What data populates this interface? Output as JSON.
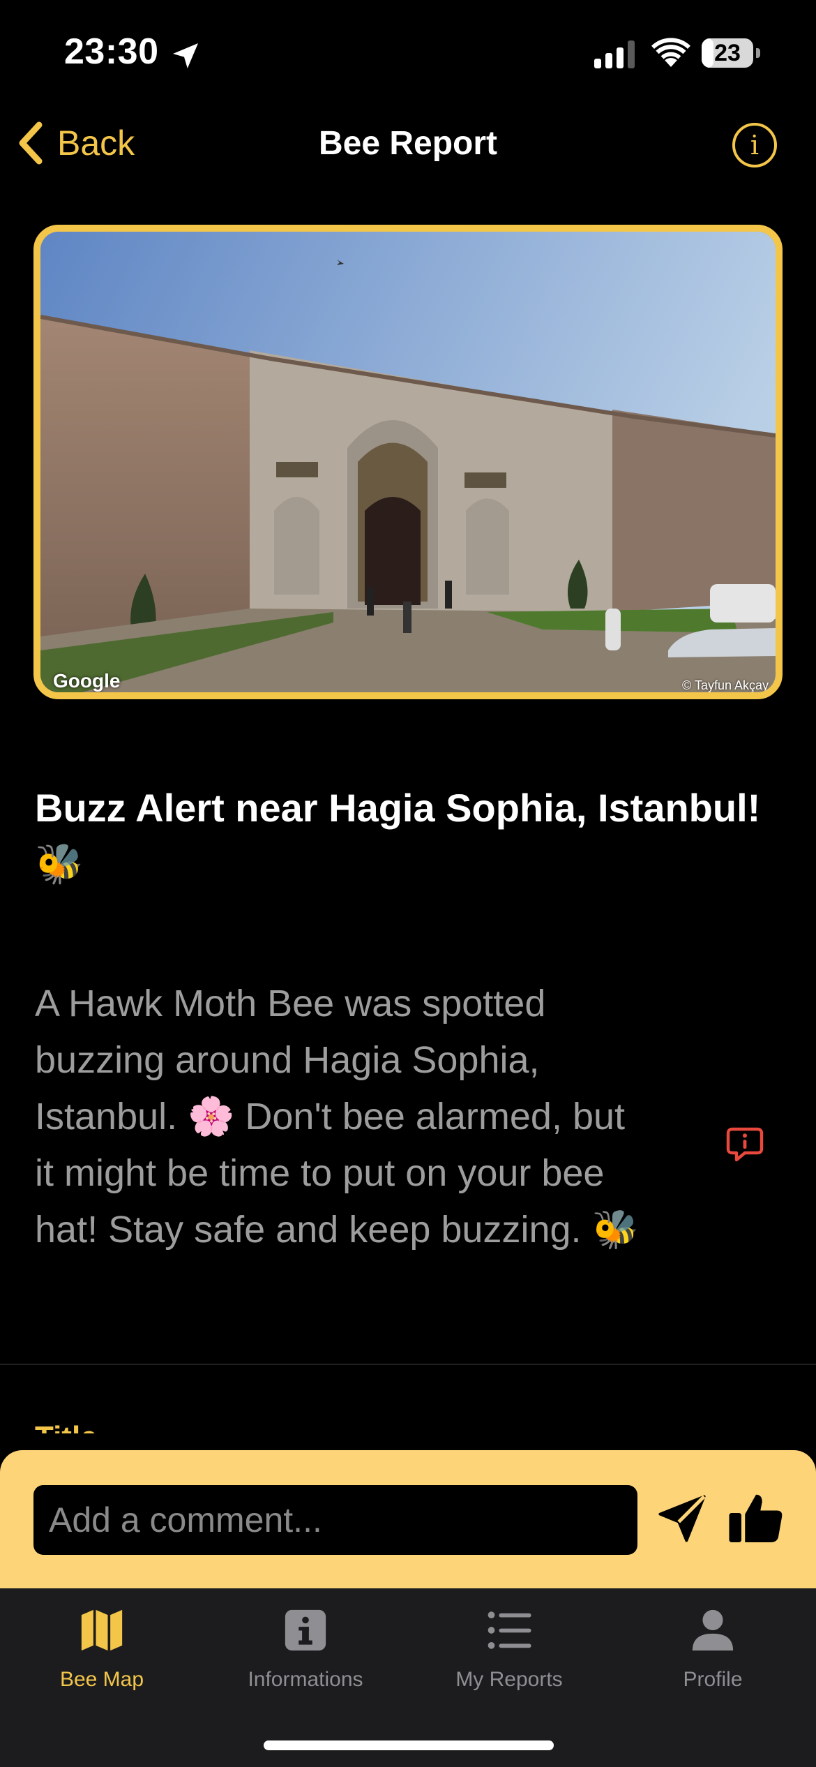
{
  "status": {
    "time": "23:30",
    "battery": "23",
    "battery_level": 0.23,
    "icons": [
      "location-arrow-icon",
      "cellular-signal-icon",
      "wifi-icon",
      "battery-icon"
    ]
  },
  "nav": {
    "back_label": "Back",
    "title": "Bee Report",
    "info_glyph": "i"
  },
  "photo": {
    "watermark": "Google",
    "credit": "© Tayfun Akçay"
  },
  "report": {
    "title": "Buzz Alert near Hagia Sophia, Istanbul! 🐝",
    "body": "A Hawk Moth Bee was spotted buzzing around Hagia Sophia, Istanbul. 🌸 Don't bee alarmed, but it might be time to put on your bee hat! Stay safe and keep buzzing. 🐝",
    "next_field_label": "Title"
  },
  "comment": {
    "placeholder": "Add a comment..."
  },
  "tabs": [
    {
      "label": "Bee Map",
      "icon": "map-icon",
      "active": true
    },
    {
      "label": "Informations",
      "icon": "info-square-icon",
      "active": false
    },
    {
      "label": "My Reports",
      "icon": "list-icon",
      "active": false
    },
    {
      "label": "Profile",
      "icon": "person-icon",
      "active": false
    }
  ],
  "colors": {
    "accent": "#f3c64a",
    "comment_bar": "#fdd578",
    "background": "#000000",
    "tab_bar": "#1c1c1e",
    "body_text": "#9d9d9d",
    "report_flag": "#e8493c",
    "inactive_tab": "#8e8e93"
  }
}
